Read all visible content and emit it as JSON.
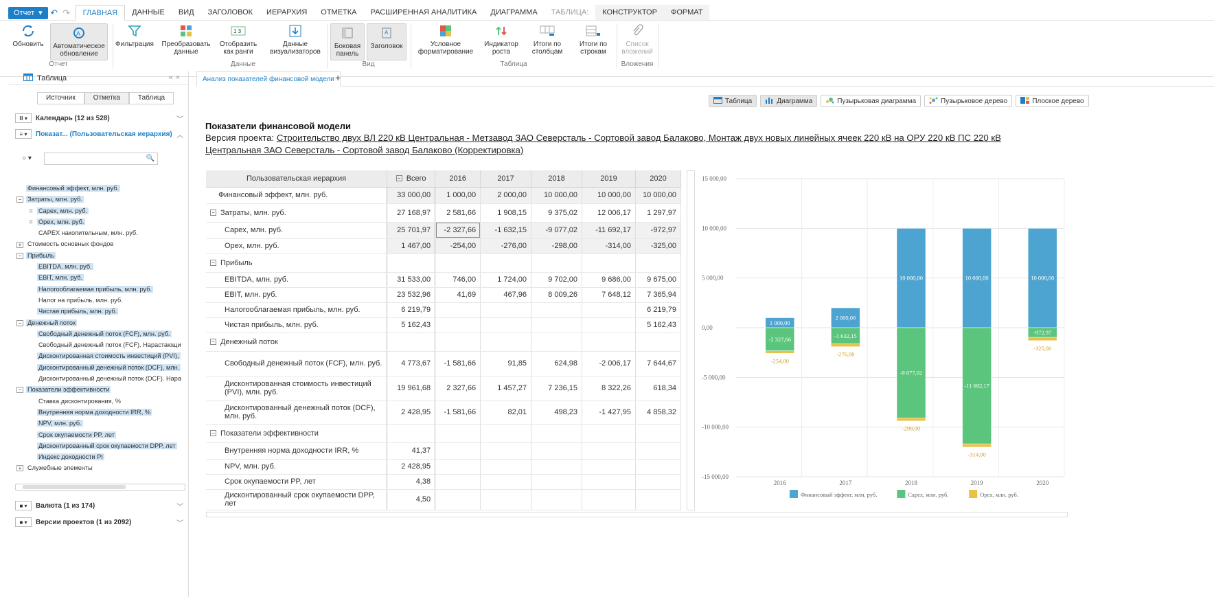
{
  "topbar": {
    "report_btn": "Отчет",
    "tabs": [
      "ГЛАВНАЯ",
      "ДАННЫЕ",
      "ВИД",
      "ЗАГОЛОВОК",
      "ИЕРАРХИЯ",
      "ОТМЕТКА",
      "РАСШИРЕННАЯ АНАЛИТИКА",
      "ДИАГРАММА",
      "ТАБЛИЦА:",
      "КОНСТРУКТОР",
      "ФОРМАТ"
    ],
    "active_tab": 0
  },
  "ribbon": {
    "refresh": "Обновить",
    "auto_refresh": "Автоматическое обновление",
    "filter": "Фильтрация",
    "transform": "Преобразовать данные",
    "ranks": "Отобразить как ранги",
    "visdata": "Данные визуализаторов",
    "sidepanel": "Боковая панель",
    "header": "Заголовок",
    "condfmt": "Условное форматирование",
    "growth": "Индикатор роста",
    "coltotals": "Итоги по столбцам",
    "rowtotals": "Итоги по строкам",
    "attachments": "Список вложений",
    "groups": {
      "report": "Отчет",
      "data": "Данные",
      "view": "Вид",
      "table": "Таблица",
      "attach": "Вложения"
    }
  },
  "left": {
    "panel_title": "Таблица",
    "tabs": [
      "Источник",
      "Отметка",
      "Таблица"
    ],
    "dim_calendar": "Календарь (12 из 528)",
    "dim_indicators": "Показат... (Пользовательская иерархия)",
    "dim_currency": "Валюта (1 из 174)",
    "dim_versions": "Версии проектов (1 из 2092)",
    "tree": [
      {
        "label": "Финансовый эффект, млн. руб.",
        "lvl": 0,
        "tg": "",
        "sel": true
      },
      {
        "label": "Затраты, млн. руб.",
        "lvl": 0,
        "tg": "⊟",
        "sel": true
      },
      {
        "label": "Capex, млн. руб.",
        "lvl": 1,
        "tg": "=",
        "sel": true
      },
      {
        "label": "Opex, млн. руб.",
        "lvl": 1,
        "tg": "=",
        "sel": true
      },
      {
        "label": "CAPEX накопительным, млн. руб.",
        "lvl": 1,
        "tg": "",
        "sel": false
      },
      {
        "label": "Стоимость основных фондов",
        "lvl": 0,
        "tg": "⊞",
        "sel": false
      },
      {
        "label": "Прибыль",
        "lvl": 0,
        "tg": "⊟",
        "sel": true
      },
      {
        "label": "EBITDA, млн. руб.",
        "lvl": 1,
        "tg": "",
        "sel": true
      },
      {
        "label": "EBIT, млн. руб.",
        "lvl": 1,
        "tg": "",
        "sel": true
      },
      {
        "label": "Налогооблагаемая прибыль, млн. руб.",
        "lvl": 1,
        "tg": "",
        "sel": true
      },
      {
        "label": "Налог на прибыль, млн. руб.",
        "lvl": 1,
        "tg": "",
        "sel": false
      },
      {
        "label": "Чистая прибыль, млн. руб.",
        "lvl": 1,
        "tg": "",
        "sel": true
      },
      {
        "label": "Денежный поток",
        "lvl": 0,
        "tg": "⊟",
        "sel": true
      },
      {
        "label": "Свободный денежный поток (FCF), млн. руб.",
        "lvl": 1,
        "tg": "",
        "sel": true
      },
      {
        "label": "Свободный денежный поток (FCF). Нарастающи",
        "lvl": 1,
        "tg": "",
        "sel": false
      },
      {
        "label": "Дисконтированная стоимость инвестиций (PVI),",
        "lvl": 1,
        "tg": "",
        "sel": true
      },
      {
        "label": "Дисконтированный денежный поток (DCF), млн.",
        "lvl": 1,
        "tg": "",
        "sel": true
      },
      {
        "label": "Дисконтированный денежный поток (DCF). Нара",
        "lvl": 1,
        "tg": "",
        "sel": false
      },
      {
        "label": "Показатели эффективности",
        "lvl": 0,
        "tg": "⊟",
        "sel": true
      },
      {
        "label": "Ставка дисконтирования, %",
        "lvl": 1,
        "tg": "",
        "sel": false
      },
      {
        "label": "Внутренняя норма доходности IRR, %",
        "lvl": 1,
        "tg": "",
        "sel": true
      },
      {
        "label": "NPV, млн. руб.",
        "lvl": 1,
        "tg": "",
        "sel": true
      },
      {
        "label": "Срок окупаемости PP, лет",
        "lvl": 1,
        "tg": "",
        "sel": true
      },
      {
        "label": "Дисконтированный срок окупаемости DPP, лет",
        "lvl": 1,
        "tg": "",
        "sel": true
      },
      {
        "label": "Индекс доходности PI",
        "lvl": 1,
        "tg": "",
        "sel": true
      },
      {
        "label": "Служебные элементы",
        "lvl": 0,
        "tg": "⊞",
        "sel": false
      }
    ]
  },
  "doc": {
    "tab": "Анализ показателей финансовой модели",
    "plus": "+",
    "views": [
      "Таблица",
      "Диаграмма",
      "Пузырьковая диаграмма",
      "Пузырьковое дерево",
      "Плоское дерево"
    ],
    "title": "Показатели финансовой модели",
    "subtitle_prefix": "Версия проекта: ",
    "subtitle_link": "Строительство двух ВЛ 220 кВ Центральная - Метзавод ЗАО Северсталь - Сортовой завод Балаково, Монтаж двух новых линейных ячеек 220 кВ на ОРУ 220 кВ ПС 220 кВ Центральная ЗАО Северсталь - Сортовой завод Балаково (Корректировка)"
  },
  "grid": {
    "corner": "Пользовательская иерархия",
    "total": "Всего",
    "years": [
      "2016",
      "2017",
      "2018",
      "2019",
      "2020"
    ],
    "rows": [
      {
        "label": "Финансовый эффект, млн. руб.",
        "ind": 0,
        "tg": "",
        "h": 24,
        "vals": [
          "33 000,00",
          "1 000,00",
          "2 000,00",
          "10 000,00",
          "10 000,00",
          "10 000,00"
        ],
        "shade": true
      },
      {
        "label": "Затраты, млн. руб.",
        "ind": 0,
        "tg": "⊟",
        "h": 27,
        "vals": [
          "27 168,97",
          "2 581,66",
          "1 908,15",
          "9 375,02",
          "12 006,17",
          "1 297,97"
        ],
        "shade": false
      },
      {
        "label": "Capex, млн. руб.",
        "ind": 1,
        "tg": "",
        "h": 24,
        "vals": [
          "25 701,97",
          "-2 327,66",
          "-1 632,15",
          "-9 077,02",
          "-11 692,17",
          "-972,97"
        ],
        "shade": true,
        "cur": 1
      },
      {
        "label": "Opex, млн. руб.",
        "ind": 1,
        "tg": "",
        "h": 22,
        "vals": [
          "1 467,00",
          "-254,00",
          "-276,00",
          "-298,00",
          "-314,00",
          "-325,00"
        ],
        "shade": true
      },
      {
        "label": "Прибыль",
        "ind": 0,
        "tg": "⊟",
        "h": 27,
        "vals": [
          "",
          "",
          "",
          "",
          "",
          ""
        ],
        "shade": false
      },
      {
        "label": "EBITDA, млн. руб.",
        "ind": 1,
        "tg": "",
        "h": 22,
        "vals": [
          "31 533,00",
          "746,00",
          "1 724,00",
          "9 702,00",
          "9 686,00",
          "9 675,00"
        ],
        "shade": false
      },
      {
        "label": "EBIT, млн. руб.",
        "ind": 1,
        "tg": "",
        "h": 22,
        "vals": [
          "23 532,96",
          "41,69",
          "467,96",
          "8 009,26",
          "7 648,12",
          "7 365,94"
        ],
        "shade": false
      },
      {
        "label": "Налогооблагаемая прибыль, млн. руб.",
        "ind": 1,
        "tg": "",
        "h": 22,
        "vals": [
          "6 219,79",
          "",
          "",
          "",
          "",
          "6 219,79"
        ],
        "shade": false
      },
      {
        "label": "Чистая прибыль, млн. руб.",
        "ind": 1,
        "tg": "",
        "h": 22,
        "vals": [
          "5 162,43",
          "",
          "",
          "",
          "",
          "5 162,43"
        ],
        "shade": false
      },
      {
        "label": "Денежный поток",
        "ind": 0,
        "tg": "⊟",
        "h": 27,
        "vals": [
          "",
          "",
          "",
          "",
          "",
          ""
        ],
        "shade": false
      },
      {
        "label": "Свободный денежный поток (FCF), млн. руб.",
        "ind": 1,
        "tg": "",
        "h": 36,
        "vals": [
          "4 773,67",
          "-1 581,66",
          "91,85",
          "624,98",
          "-2 006,17",
          "7 644,67"
        ],
        "shade": false
      },
      {
        "label": "Дисконтированная стоимость инвестиций (PVI), млн. руб.",
        "ind": 1,
        "tg": "",
        "h": 36,
        "vals": [
          "19 961,68",
          "2 327,66",
          "1 457,27",
          "7 236,15",
          "8 322,26",
          "618,34"
        ],
        "shade": false
      },
      {
        "label": "Дисконтированный денежный поток (DCF), млн. руб.",
        "ind": 1,
        "tg": "",
        "h": 34,
        "vals": [
          "2 428,95",
          "-1 581,66",
          "82,01",
          "498,23",
          "-1 427,95",
          "4 858,32"
        ],
        "shade": false
      },
      {
        "label": "Показатели эффективности",
        "ind": 0,
        "tg": "⊟",
        "h": 27,
        "vals": [
          "",
          "",
          "",
          "",
          "",
          ""
        ],
        "shade": false
      },
      {
        "label": "Внутренняя норма доходности IRR, %",
        "ind": 1,
        "tg": "",
        "h": 24,
        "vals": [
          "41,37",
          "",
          "",
          "",
          "",
          ""
        ],
        "shade": false
      },
      {
        "label": "NPV, млн. руб.",
        "ind": 1,
        "tg": "",
        "h": 22,
        "vals": [
          "2 428,95",
          "",
          "",
          "",
          "",
          ""
        ],
        "shade": false
      },
      {
        "label": "Срок окупаемости PP, лет",
        "ind": 1,
        "tg": "",
        "h": 22,
        "vals": [
          "4,38",
          "",
          "",
          "",
          "",
          ""
        ],
        "shade": false
      },
      {
        "label": "Дисконтированный срок окупаемости DPP, лет",
        "ind": 1,
        "tg": "",
        "h": 30,
        "vals": [
          "4,50",
          "",
          "",
          "",
          "",
          ""
        ],
        "shade": false
      }
    ]
  },
  "chart_data": {
    "type": "bar",
    "stacked": true,
    "categories": [
      "2016",
      "2017",
      "2018",
      "2019",
      "2020"
    ],
    "series": [
      {
        "name": "Финансовый эффект, млн. руб.",
        "values": [
          1000,
          2000,
          10000,
          10000,
          10000
        ],
        "labels": [
          "1 000,00",
          "2 000,00",
          "10 000,00",
          "10 000,00",
          "10 000,00"
        ],
        "color": "#4ea4d0"
      },
      {
        "name": "Capex, млн. руб.",
        "values": [
          -2327.66,
          -1632.15,
          -9077.02,
          -11692.17,
          -972.97
        ],
        "labels": [
          "-2 327,66",
          "-1 632,15",
          "-9 077,02",
          "-11 692,17",
          "-972,97"
        ],
        "color": "#5bc47d"
      },
      {
        "name": "Opex, млн. руб.",
        "values": [
          -254,
          -276,
          -298,
          -314,
          -325
        ],
        "labels": [
          "-254,00",
          "-276,00",
          "-298,00",
          "-314,00",
          "-325,00"
        ],
        "color": "#e8c246"
      }
    ],
    "ylim": [
      -15000,
      15000
    ],
    "yticks": [
      15000,
      10000,
      5000,
      0,
      -5000,
      -10000,
      -15000
    ],
    "ytick_labels": [
      "15 000,00",
      "10 000,00",
      "5 000,00",
      "0,00",
      "-5 000,00",
      "-10 000,00",
      "-15 000,00"
    ],
    "grid": true,
    "legend": "bottom"
  }
}
